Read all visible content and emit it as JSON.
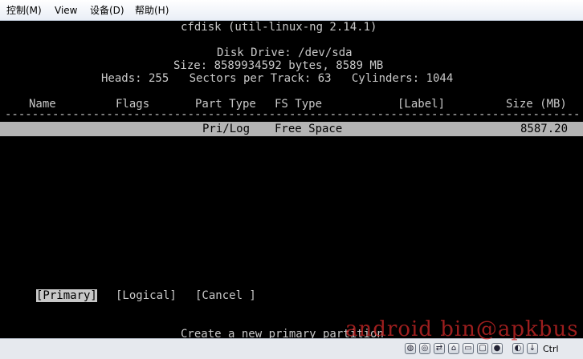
{
  "menubar": {
    "items": [
      "控制(M)",
      "View",
      "设备(D)",
      "帮助(H)"
    ]
  },
  "cfdisk": {
    "title": "cfdisk (util-linux-ng 2.14.1)",
    "disk_drive": "Disk Drive: /dev/sda",
    "size_line": "Size: 8589934592 bytes, 8589 MB",
    "geometry": "Heads: 255   Sectors per Track: 63   Cylinders: 1044",
    "columns": {
      "name": "Name",
      "flags": "Flags",
      "part_type": "Part Type",
      "fs_type": "FS Type",
      "label": "[Label]",
      "size": "Size (MB)"
    },
    "separator": "------------------------------------------------------------------------------------------",
    "row": {
      "part_type": "Pri/Log",
      "fs_type": "Free Space",
      "size": "8587.20"
    },
    "buttons": {
      "primary": "[Primary]",
      "logical": "[Logical]",
      "cancel": "[Cancel ]"
    },
    "status": "Create a new primary partition"
  },
  "statusbar": {
    "keyboard": "Ctrl",
    "icons": [
      "hard-disk-icon",
      "cd-drive-icon",
      "usb-icon",
      "network-icon",
      "shared-folder-icon",
      "display-icon",
      "record-icon",
      "mouse-integration-icon",
      "host-key-icon"
    ]
  },
  "watermark": "android bin@apkbus"
}
